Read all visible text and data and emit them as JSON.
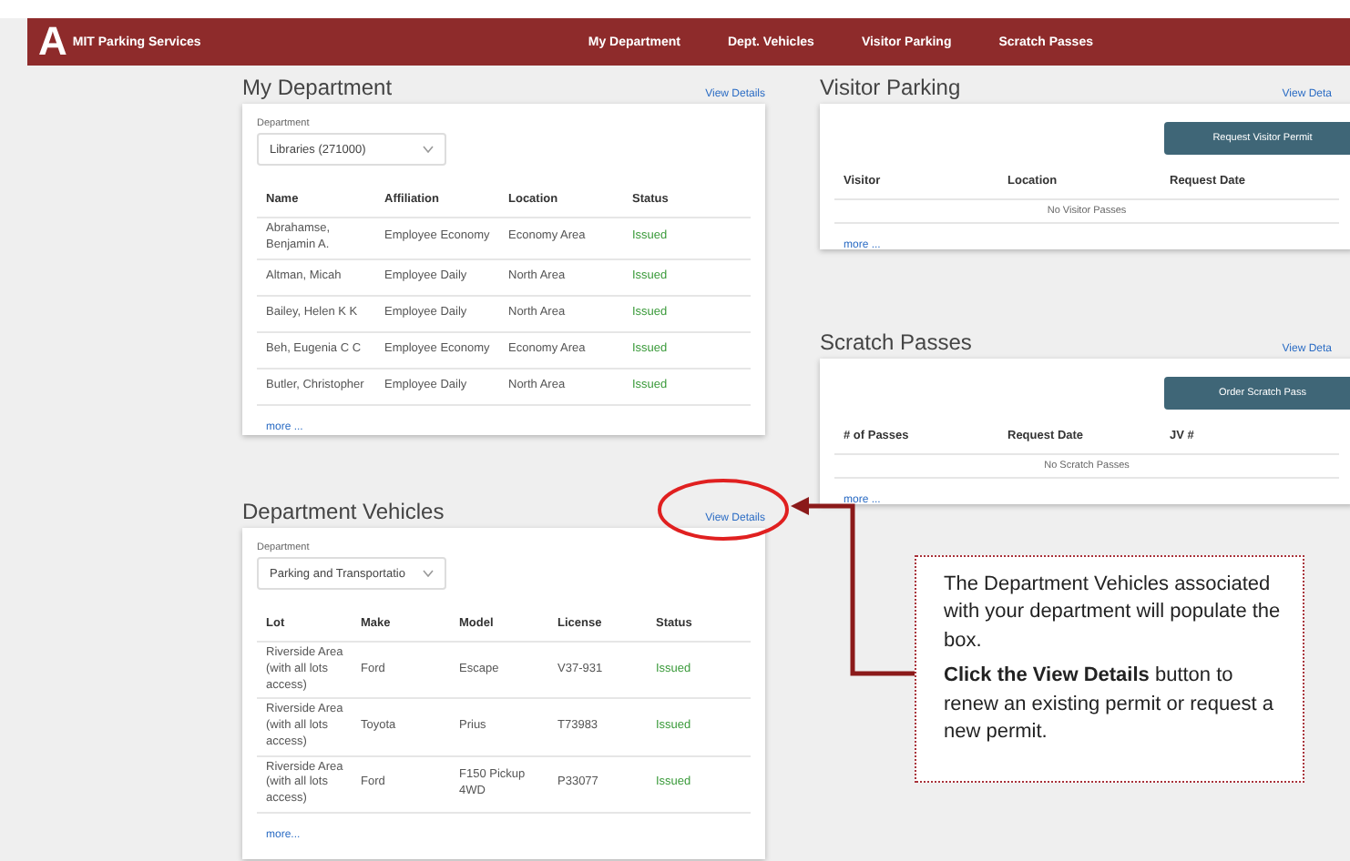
{
  "header": {
    "logo": "A",
    "brand": "MIT Parking Services",
    "nav": [
      "My Department",
      "Dept. Vehicles",
      "Visitor Parking",
      "Scratch Passes"
    ]
  },
  "my_department": {
    "title": "My Department",
    "link": "View Details",
    "field_label": "Department",
    "field_value": "Libraries (271000)",
    "columns": [
      "Name",
      "Affiliation",
      "Location",
      "Status"
    ],
    "rows": [
      [
        "Abrahamse, Benjamin A.",
        "Employee Economy",
        "Economy Area",
        "Issued"
      ],
      [
        "Altman, Micah",
        "Employee Daily",
        "North Area",
        "Issued"
      ],
      [
        "Bailey, Helen K K",
        "Employee Daily",
        "North Area",
        "Issued"
      ],
      [
        "Beh, Eugenia C C",
        "Employee Economy",
        "Economy Area",
        "Issued"
      ],
      [
        "Butler, Christopher",
        "Employee Daily",
        "North Area",
        "Issued"
      ]
    ],
    "more": "more ..."
  },
  "department_vehicles": {
    "title": "Department Vehicles",
    "link": "View Details",
    "field_label": "Department",
    "field_value": "Parking and Transportatio",
    "columns": [
      "Lot",
      "Make",
      "Model",
      "License",
      "Status"
    ],
    "rows": [
      [
        "Riverside Area (with all lots access)",
        "Ford",
        "Escape",
        "V37-931",
        "Issued"
      ],
      [
        "Riverside Area (with all lots access)",
        "Toyota",
        "Prius",
        "T73983",
        "Issued"
      ],
      [
        "Riverside Area (with all lots access)",
        "Ford",
        "F150 Pickup 4WD",
        "P33077",
        "Issued"
      ]
    ],
    "more": "more..."
  },
  "visitor_parking": {
    "title": "Visitor Parking",
    "link": "View Deta",
    "button": "Request Visitor Permit",
    "columns": [
      "Visitor",
      "Location",
      "Request Date"
    ],
    "empty": "No Visitor Passes",
    "more": "more ..."
  },
  "scratch_passes": {
    "title": "Scratch Passes",
    "link": "View Deta",
    "button": "Order Scratch Pass",
    "columns": [
      "# of Passes",
      "Request Date",
      "JV #"
    ],
    "empty": "No Scratch Passes",
    "more": "more ..."
  },
  "callout": {
    "paragraphs": [
      "The Department Vehicles associated with your department will populate the box.",
      "**Click the View Details** button to renew an existing permit or request a new permit."
    ]
  }
}
